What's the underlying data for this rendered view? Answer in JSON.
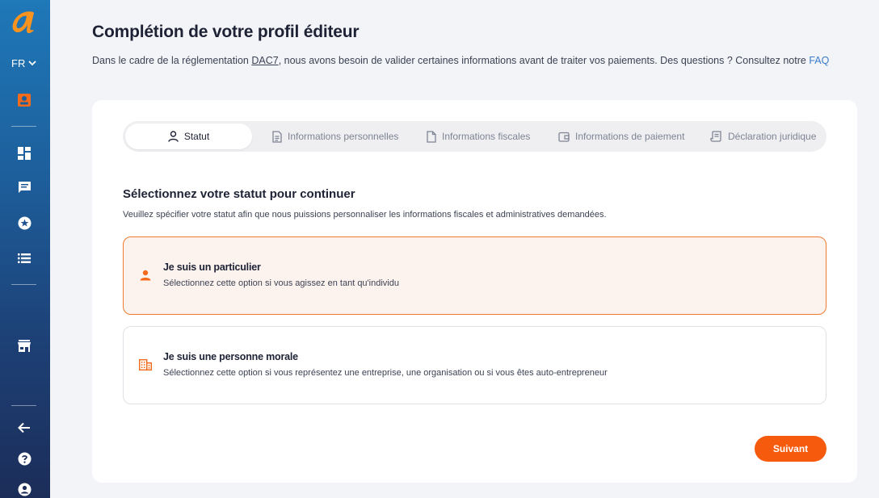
{
  "sidebar": {
    "language": "FR",
    "icons": [
      "logo-icon",
      "profile-badge-icon",
      "dashboard-icon",
      "messages-icon",
      "star-icon",
      "list-icon",
      "store-icon",
      "back-arrow-icon",
      "help-icon",
      "account-icon"
    ]
  },
  "header": {
    "title": "Complétion de votre profil éditeur",
    "subtitle_before": "Dans le cadre de la réglementation ",
    "subtitle_link": "DAC7",
    "subtitle_after": ", nous avons besoin de valider certaines informations avant de traiter vos paiements. Des questions ? Consultez notre ",
    "faq_link": "FAQ"
  },
  "stepper": {
    "steps": [
      {
        "label": "Statut",
        "icon": "person-icon",
        "active": true
      },
      {
        "label": "Informations personnelles",
        "icon": "document-lines-icon",
        "active": false
      },
      {
        "label": "Informations fiscales",
        "icon": "document-icon",
        "active": false
      },
      {
        "label": "Informations de paiement",
        "icon": "wallet-icon",
        "active": false
      },
      {
        "label": "Déclaration juridique",
        "icon": "scroll-icon",
        "active": false
      }
    ]
  },
  "status_section": {
    "title": "Sélectionnez votre statut pour continuer",
    "subtitle": "Veuillez spécifier votre statut afin que nous puissions personnaliser les informations fiscales et administratives demandées.",
    "options": [
      {
        "title": "Je suis un particulier",
        "description": "Sélectionnez cette option si vous agissez en tant qu'individu",
        "icon": "person-icon",
        "selected": true
      },
      {
        "title": "Je suis une personne morale",
        "description": "Sélectionnez cette option si vous représentez une entreprise, une organisation ou si vous êtes auto-entrepreneur",
        "icon": "building-icon",
        "selected": false
      }
    ]
  },
  "actions": {
    "next_label": "Suivant"
  },
  "colors": {
    "accent": "#f55a0d",
    "selected_bg": "#fdf3ee",
    "selected_border": "#f07b2f",
    "link": "#3a7bc8",
    "sidebar_top": "#1f78b8",
    "sidebar_bottom": "#1c2d59"
  }
}
